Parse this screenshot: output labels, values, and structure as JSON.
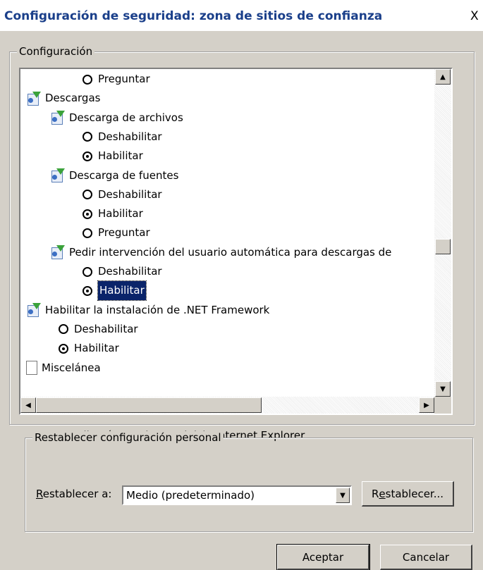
{
  "dialog": {
    "title": "Configuración de seguridad: zona de sitios de confianza",
    "close_glyph": "X"
  },
  "settings_group": {
    "legend": "Configuración"
  },
  "tree": [
    {
      "kind": "radio",
      "indent": 2,
      "label": "Preguntar",
      "checked": false,
      "selected": false
    },
    {
      "kind": "category",
      "indent": 0,
      "label": "Descargas",
      "icon": "download-settings-icon"
    },
    {
      "kind": "category",
      "indent": 1,
      "label": "Descarga de archivos",
      "icon": "download-settings-icon"
    },
    {
      "kind": "radio",
      "indent": 2,
      "label": "Deshabilitar",
      "checked": false,
      "selected": false
    },
    {
      "kind": "radio",
      "indent": 2,
      "label": "Habilitar",
      "checked": true,
      "selected": false
    },
    {
      "kind": "category",
      "indent": 1,
      "label": "Descarga de fuentes",
      "icon": "download-settings-icon"
    },
    {
      "kind": "radio",
      "indent": 2,
      "label": "Deshabilitar",
      "checked": false,
      "selected": false
    },
    {
      "kind": "radio",
      "indent": 2,
      "label": "Habilitar",
      "checked": true,
      "selected": false
    },
    {
      "kind": "radio",
      "indent": 2,
      "label": "Preguntar",
      "checked": false,
      "selected": false
    },
    {
      "kind": "category",
      "indent": 1,
      "label": "Pedir intervención del usuario automática para descargas de",
      "icon": "download-settings-icon"
    },
    {
      "kind": "radio",
      "indent": 2,
      "label": "Deshabilitar",
      "checked": false,
      "selected": false
    },
    {
      "kind": "radio",
      "indent": 2,
      "label": "Habilitar",
      "checked": true,
      "selected": true
    },
    {
      "kind": "category",
      "indent": 0,
      "label": "Habilitar la instalación de .NET Framework",
      "icon": "download-settings-icon"
    },
    {
      "kind": "radio",
      "indent": 1,
      "label": "Deshabilitar",
      "checked": false,
      "selected": false
    },
    {
      "kind": "radio",
      "indent": 1,
      "label": "Habilitar",
      "checked": true,
      "selected": false
    },
    {
      "kind": "doc",
      "indent": 0,
      "label": "Miscelánea",
      "icon": "document-icon"
    }
  ],
  "restart_note": "* Se aplicará cuando se reinicie Internet Explorer",
  "reset_group": {
    "legend": "Restablecer configuración personal",
    "label_prefix": "R",
    "label_rest": "establecer a:",
    "combo_value": "Medio (predeterminado)",
    "reset_button_prefix": "R",
    "reset_button_underlined": "e",
    "reset_button_rest": "stablecer..."
  },
  "buttons": {
    "ok": "Aceptar",
    "cancel": "Cancelar"
  },
  "scrollbar": {
    "vertical_position": 0.55
  }
}
